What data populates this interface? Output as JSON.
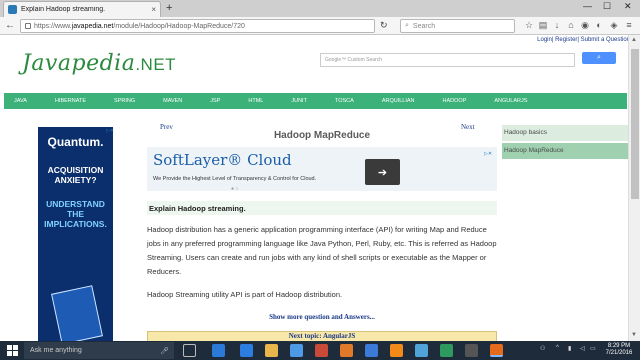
{
  "browser": {
    "tab_title": "Explain Hadoop streaming.",
    "tab_close": "×",
    "new_tab": "+",
    "win_min": "—",
    "win_max": "☐",
    "win_close": "✕",
    "back": "←",
    "url_prefix": "https://www.",
    "url_host": "javapedia.net",
    "url_path": "/module/Hadoop/Hadoop-MapReduce/720",
    "reload": "↻",
    "search_placeholder": "Search"
  },
  "header": {
    "toplinks": "Login| Register| Submit a Question",
    "logo_main": "Javapedia",
    "logo_ext": ".NET",
    "custom_search_placeholder": "Google™ Custom Search"
  },
  "menu": [
    "JAVA",
    "HIBERNATE",
    "SPRING",
    "MAVEN",
    "JSP",
    "HTML",
    "JUNIT",
    "TOSCA",
    "ARQUILLIAN",
    "HADOOP",
    "ANGULARJS"
  ],
  "left_ad": {
    "brand": "Quantum.",
    "line1": "ACQUISITION ANXIETY?",
    "line2": "UNDERSTAND THE IMPLICATIONS."
  },
  "main": {
    "prev": "Prev",
    "next": "Next",
    "title": "Hadoop MapReduce",
    "ad_brand": "SoftLayer® Cloud",
    "ad_tagline": "We Provide the Highest Level of Transparency & Control for Cloud.",
    "ad_arrow": "➔",
    "ad_dots": "● ○",
    "question": "Explain Hadoop streaming.",
    "answer_1": "Hadoop distribution has a generic application programming interface (API) for writing Map and Reduce jobs in any preferred programming language like Java Python, Perl, Ruby, etc. This is referred as Hadoop Streaming. Users can create and run jobs with any kind of shell scripts or executable as the Mapper or Reducers.",
    "answer_2": "Hadoop Streaming utility API is part of Hadoop distribution.",
    "more_link": "Show more question and Answers...",
    "next_topic": "Next topic: AngularJS"
  },
  "sidebar": [
    "Hadoop basics",
    "Hadoop MapReduce"
  ],
  "taskbar": {
    "search_placeholder": "Ask me anything",
    "time": "8:29 PM",
    "date": "7/21/2016"
  },
  "colors": {
    "menu_green": "#3cb27a",
    "sidebar_active": "#9fd1b0",
    "taskbar": "#1e2b3b"
  }
}
